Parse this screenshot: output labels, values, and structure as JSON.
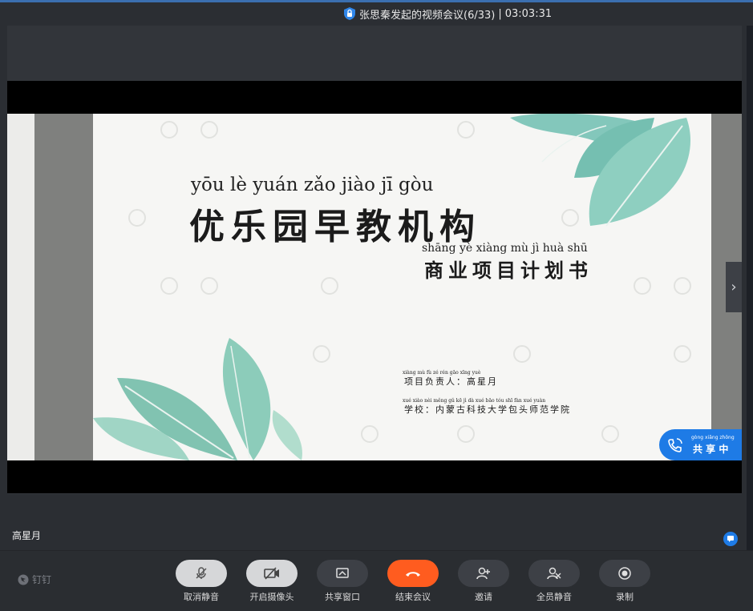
{
  "window": {
    "title": "张思秦发起的视频会议(6/33)",
    "separator": "|",
    "elapsed": "03:03:31"
  },
  "slide": {
    "title_pinyin": "yōu   lè   yuán zǎo jiào   jī   gòu",
    "title": "优乐园早教机构",
    "subtitle_pinyin": "shāng  yè  xiàng  mù    jì    huà  shū",
    "subtitle": "商业项目计划书",
    "leader_pinyin": "xiàng  mù   fù  zé  rén            gāo xīng yuè",
    "leader_label": "项目负责人：",
    "leader_name": "高星月",
    "school_pinyin": "xué xiào      nèi měng gǔ  kē   jì   dà  xué bāo tóu shī fàn xué yuàn",
    "school_label": "学校：",
    "school_name": "内蒙古科技大学包头师范学院"
  },
  "share_badge": {
    "pinyin": "gòng xiǎng zhōng",
    "label": "共 享 中"
  },
  "speaker": {
    "name": "高星月"
  },
  "brand": {
    "name": "钉钉"
  },
  "toolbar": {
    "buttons": [
      {
        "label": "取消静音",
        "icon": "mic-off-icon"
      },
      {
        "label": "开启摄像头",
        "icon": "camera-off-icon"
      },
      {
        "label": "共享窗口",
        "icon": "share-window-icon"
      },
      {
        "label": "结束会议",
        "icon": "hang-up-icon"
      },
      {
        "label": "邀请",
        "icon": "invite-user-icon"
      },
      {
        "label": "全员静音",
        "icon": "mute-all-icon"
      },
      {
        "label": "录制",
        "icon": "record-icon"
      }
    ]
  },
  "colors": {
    "accent": "#1e7be6",
    "end_call": "#ff5c1f",
    "background": "#2b2e33"
  }
}
